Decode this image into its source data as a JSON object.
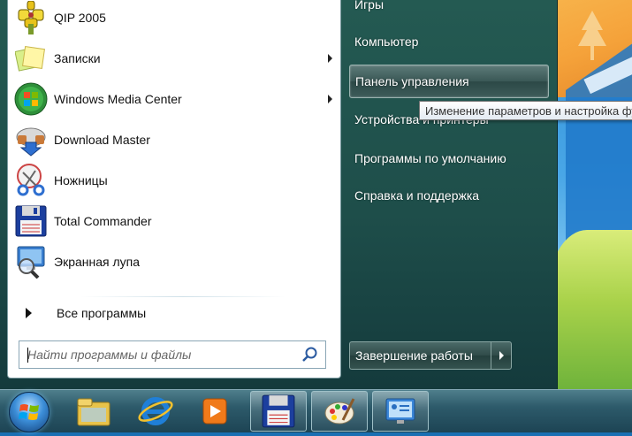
{
  "start_menu": {
    "programs": [
      {
        "label": "QIP 2005",
        "icon": "qip-flower-icon",
        "has_submenu": false
      },
      {
        "label": "Записки",
        "icon": "sticky-notes-icon",
        "has_submenu": true
      },
      {
        "label": "Windows Media Center",
        "icon": "media-center-icon",
        "has_submenu": true
      },
      {
        "label": "Download Master",
        "icon": "download-master-icon",
        "has_submenu": false
      },
      {
        "label": "Ножницы",
        "icon": "scissors-icon",
        "has_submenu": false
      },
      {
        "label": "Total Commander",
        "icon": "floppy-disk-icon",
        "has_submenu": false
      },
      {
        "label": "Экранная лупа",
        "icon": "magnifier-icon",
        "has_submenu": false
      }
    ],
    "all_programs_label": "Все программы",
    "search": {
      "placeholder": "Найти программы и файлы",
      "value": ""
    },
    "right_items": [
      {
        "label": "Игры",
        "active": false
      },
      {
        "label": "Компьютер",
        "active": false
      },
      {
        "label": "Панель управления",
        "active": true
      },
      {
        "label": "Устройства и принтеры",
        "active": false
      },
      {
        "label": "Программы по умолчанию",
        "active": false
      },
      {
        "label": "Справка и поддержка",
        "active": false
      }
    ],
    "shutdown_label": "Завершение работы",
    "tooltip": "Изменение параметров и настройка функциональных возможностей компьютера."
  },
  "taskbar": {
    "items": [
      {
        "name": "explorer-icon",
        "open": false
      },
      {
        "name": "internet-explorer-icon",
        "open": false
      },
      {
        "name": "media-player-icon",
        "open": false
      },
      {
        "name": "total-commander-icon",
        "open": true
      },
      {
        "name": "paint-icon",
        "open": true
      },
      {
        "name": "control-panel-icon",
        "open": true
      }
    ]
  },
  "colors": {
    "menu_dark": "#1e4e4a",
    "left_pane": "#ffffff",
    "highlight": "#3a5856",
    "taskbar": "#2d5a6a"
  }
}
